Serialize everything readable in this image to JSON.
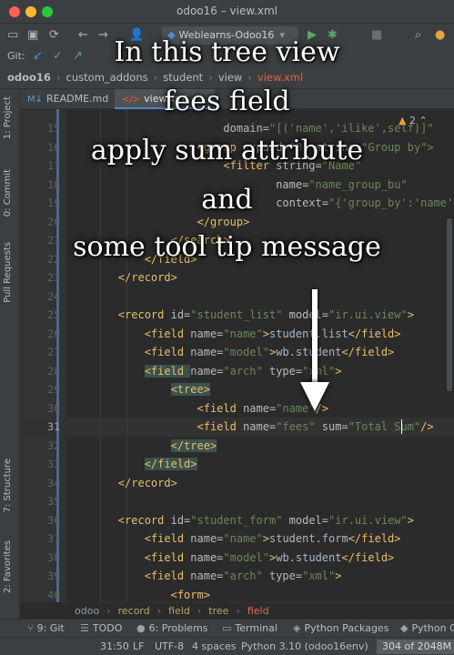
{
  "window": {
    "title": "odoo16 – view.xml"
  },
  "toolbar": {
    "run_config": "Weblearns-Odoo16"
  },
  "vcs": {
    "label": "Git:"
  },
  "breadcrumbs": [
    "odoo16",
    "custom_addons",
    "student",
    "view",
    "view.xml"
  ],
  "tabs": [
    {
      "label": "README.md",
      "active": false
    },
    {
      "label": "view.xml",
      "active": true
    }
  ],
  "left_tools": [
    "1: Project",
    "0: Commit",
    "Pull Requests",
    "7: Structure",
    "2: Favorites"
  ],
  "inspection": {
    "count": "2"
  },
  "editor": {
    "lines": [
      {
        "num": "15",
        "parts": [
          {
            "t": "                        ",
            "c": "text"
          },
          {
            "t": "domain=",
            "c": "attr"
          },
          {
            "t": "\"[('name','ilike',self)]\"",
            "c": "val"
          }
        ]
      },
      {
        "num": "16",
        "parts": [
          {
            "t": "                    ",
            "c": "text"
          },
          {
            "t": "<group ",
            "c": "tag"
          },
          {
            "t": "expand=",
            "c": "attr"
          },
          {
            "t": "\"0\" ",
            "c": "val"
          },
          {
            "t": "string=",
            "c": "attr"
          },
          {
            "t": "\"Group by\">",
            "c": "val"
          }
        ]
      },
      {
        "num": "17",
        "parts": [
          {
            "t": "                        ",
            "c": "text"
          },
          {
            "t": "<filter ",
            "c": "tag"
          },
          {
            "t": "string=",
            "c": "attr"
          },
          {
            "t": "\"Name\"",
            "c": "val"
          }
        ]
      },
      {
        "num": "18",
        "parts": [
          {
            "t": "                                ",
            "c": "text"
          },
          {
            "t": "name=",
            "c": "attr"
          },
          {
            "t": "\"name_group_bu\"",
            "c": "val"
          }
        ]
      },
      {
        "num": "19",
        "parts": [
          {
            "t": "                                ",
            "c": "text"
          },
          {
            "t": "context=",
            "c": "attr"
          },
          {
            "t": "\"{'group_by':'name'}\"",
            "c": "val"
          }
        ]
      },
      {
        "num": "20",
        "parts": [
          {
            "t": "                    ",
            "c": "text"
          },
          {
            "t": "</group>",
            "c": "tag"
          }
        ]
      },
      {
        "num": "21",
        "parts": [
          {
            "t": "                ",
            "c": "text"
          },
          {
            "t": "</search>",
            "c": "tag"
          }
        ]
      },
      {
        "num": "22",
        "parts": [
          {
            "t": "            ",
            "c": "text"
          },
          {
            "t": "</field>",
            "c": "tag"
          }
        ]
      },
      {
        "num": "23",
        "parts": [
          {
            "t": "        ",
            "c": "text"
          },
          {
            "t": "</record>",
            "c": "tag"
          }
        ]
      },
      {
        "num": "24",
        "parts": []
      },
      {
        "num": "25",
        "parts": [
          {
            "t": "        ",
            "c": "text"
          },
          {
            "t": "<record ",
            "c": "tag"
          },
          {
            "t": "id=",
            "c": "attr"
          },
          {
            "t": "\"student_list\" ",
            "c": "val"
          },
          {
            "t": "model=",
            "c": "attr"
          },
          {
            "t": "\"ir.ui.view\"",
            "c": "val"
          },
          {
            "t": ">",
            "c": "tag"
          }
        ]
      },
      {
        "num": "26",
        "parts": [
          {
            "t": "            ",
            "c": "text"
          },
          {
            "t": "<field ",
            "c": "tag"
          },
          {
            "t": "name=",
            "c": "attr"
          },
          {
            "t": "\"name\"",
            "c": "val"
          },
          {
            "t": ">",
            "c": "tag"
          },
          {
            "t": "student.list",
            "c": "text"
          },
          {
            "t": "</field>",
            "c": "tag"
          }
        ]
      },
      {
        "num": "27",
        "parts": [
          {
            "t": "            ",
            "c": "text"
          },
          {
            "t": "<field ",
            "c": "tag"
          },
          {
            "t": "name=",
            "c": "attr"
          },
          {
            "t": "\"model\"",
            "c": "val"
          },
          {
            "t": ">",
            "c": "tag"
          },
          {
            "t": "wb.student",
            "c": "text"
          },
          {
            "t": "</field>",
            "c": "tag"
          }
        ]
      },
      {
        "num": "28",
        "parts": [
          {
            "t": "            ",
            "c": "text"
          },
          {
            "t": "<field ",
            "c": "tag-hl"
          },
          {
            "t": "name=",
            "c": "attr"
          },
          {
            "t": "\"arch\" ",
            "c": "val"
          },
          {
            "t": "type=",
            "c": "attr"
          },
          {
            "t": "\"xml\"",
            "c": "val"
          },
          {
            "t": ">",
            "c": "tag"
          }
        ]
      },
      {
        "num": "29",
        "parts": [
          {
            "t": "                ",
            "c": "text"
          },
          {
            "t": "<tree>",
            "c": "tag-hl"
          }
        ]
      },
      {
        "num": "30",
        "parts": [
          {
            "t": "                    ",
            "c": "text"
          },
          {
            "t": "<field ",
            "c": "tag"
          },
          {
            "t": "name=",
            "c": "attr"
          },
          {
            "t": "\"name\"",
            "c": "val"
          },
          {
            "t": "/>",
            "c": "tag"
          }
        ]
      },
      {
        "num": "31",
        "current": true,
        "parts": [
          {
            "t": "                    ",
            "c": "text"
          },
          {
            "t": "<field ",
            "c": "tag"
          },
          {
            "t": "name=",
            "c": "attr"
          },
          {
            "t": "\"fees\" ",
            "c": "val"
          },
          {
            "t": "sum=",
            "c": "attr"
          },
          {
            "t": "\"Total Sum\"",
            "c": "val"
          },
          {
            "t": "/>",
            "c": "tag"
          }
        ]
      },
      {
        "num": "32",
        "parts": [
          {
            "t": "                ",
            "c": "text"
          },
          {
            "t": "</tree>",
            "c": "tag-hl"
          }
        ]
      },
      {
        "num": "33",
        "parts": [
          {
            "t": "            ",
            "c": "text"
          },
          {
            "t": "</field>",
            "c": "tag-hl"
          }
        ]
      },
      {
        "num": "34",
        "parts": [
          {
            "t": "        ",
            "c": "text"
          },
          {
            "t": "</record>",
            "c": "tag"
          }
        ]
      },
      {
        "num": "35",
        "parts": []
      },
      {
        "num": "36",
        "parts": [
          {
            "t": "        ",
            "c": "text"
          },
          {
            "t": "<record ",
            "c": "tag"
          },
          {
            "t": "id=",
            "c": "attr"
          },
          {
            "t": "\"student_form\" ",
            "c": "val"
          },
          {
            "t": "model=",
            "c": "attr"
          },
          {
            "t": "\"ir.ui.view\"",
            "c": "val"
          },
          {
            "t": ">",
            "c": "tag"
          }
        ]
      },
      {
        "num": "37",
        "parts": [
          {
            "t": "            ",
            "c": "text"
          },
          {
            "t": "<field ",
            "c": "tag"
          },
          {
            "t": "name=",
            "c": "attr"
          },
          {
            "t": "\"name\"",
            "c": "val"
          },
          {
            "t": ">",
            "c": "tag"
          },
          {
            "t": "student.form",
            "c": "text"
          },
          {
            "t": "</field>",
            "c": "tag"
          }
        ]
      },
      {
        "num": "38",
        "parts": [
          {
            "t": "            ",
            "c": "text"
          },
          {
            "t": "<field ",
            "c": "tag"
          },
          {
            "t": "name=",
            "c": "attr"
          },
          {
            "t": "\"model\"",
            "c": "val"
          },
          {
            "t": ">",
            "c": "tag"
          },
          {
            "t": "wb.student",
            "c": "text"
          },
          {
            "t": "</field>",
            "c": "tag"
          }
        ]
      },
      {
        "num": "39",
        "parts": [
          {
            "t": "            ",
            "c": "text"
          },
          {
            "t": "<field ",
            "c": "tag"
          },
          {
            "t": "name=",
            "c": "attr"
          },
          {
            "t": "\"arch\" ",
            "c": "val"
          },
          {
            "t": "type=",
            "c": "attr"
          },
          {
            "t": "\"xml\"",
            "c": "val"
          },
          {
            "t": ">",
            "c": "tag"
          }
        ]
      },
      {
        "num": "40",
        "parts": [
          {
            "t": "                ",
            "c": "text"
          },
          {
            "t": "<form>",
            "c": "tag"
          }
        ]
      }
    ]
  },
  "editor_breadcrumbs": [
    "odoo",
    "record",
    "field",
    "tree",
    "field"
  ],
  "bottom_tools": [
    "9: Git",
    "TODO",
    "6: Problems",
    "Terminal",
    "Python Packages",
    "Python C"
  ],
  "status": {
    "position": "31:50",
    "line_sep": "LF",
    "encoding": "UTF-8",
    "indent": "4 spaces",
    "interpreter": "Python 3.10 (odoo16env)",
    "memory": "304 of 2048M"
  },
  "overlay": {
    "lines": [
      "In this tree view",
      "fees field",
      "apply sum attribute",
      "and",
      "some tool tip message"
    ]
  },
  "colors": {
    "accent": "#4a88c7",
    "xml_tag": "#e8bf6a",
    "xml_value": "#6a8759",
    "xml_file": "#e8603c"
  }
}
